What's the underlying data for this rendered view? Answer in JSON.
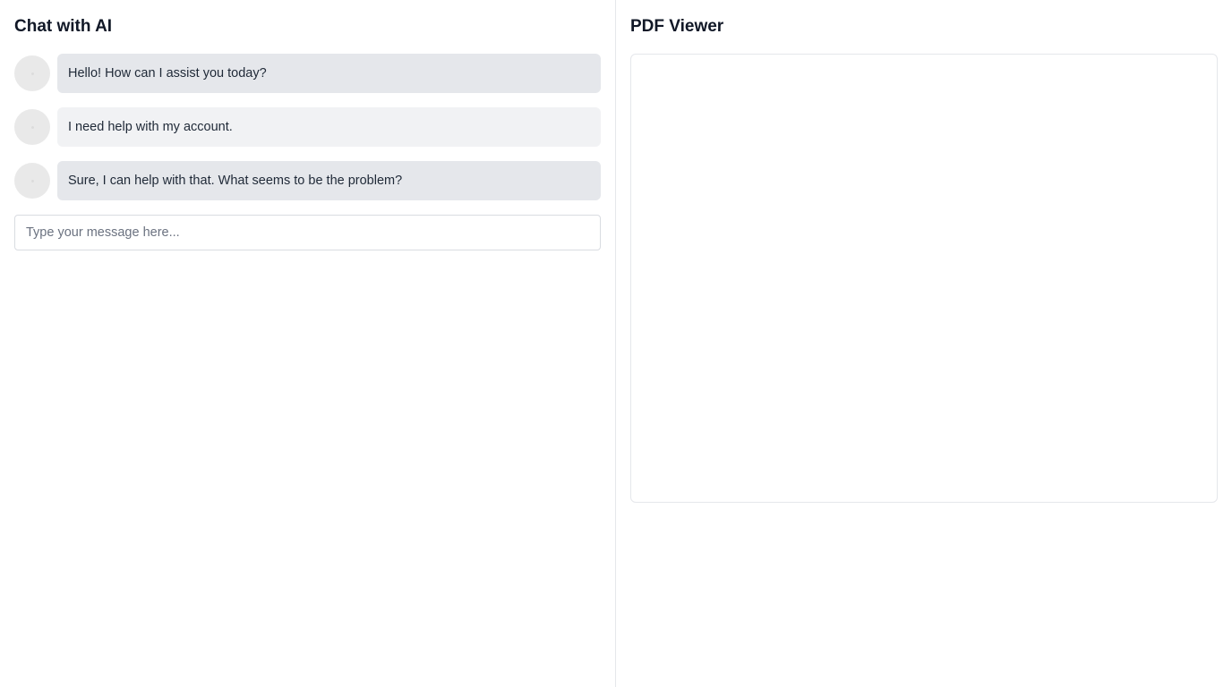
{
  "chat": {
    "title": "Chat with AI",
    "messages": [
      {
        "sender": "ai",
        "text": "Hello! How can I assist you today?"
      },
      {
        "sender": "user",
        "text": "I need help with my account."
      },
      {
        "sender": "ai",
        "text": "Sure, I can help with that. What seems to be the problem?"
      }
    ],
    "input": {
      "value": "",
      "placeholder": "Type your message here..."
    }
  },
  "pdf": {
    "title": "PDF Viewer"
  },
  "colors": {
    "ai_bubble": "#e5e7eb",
    "user_bubble": "#f1f2f4",
    "divider": "#e5e7eb"
  }
}
